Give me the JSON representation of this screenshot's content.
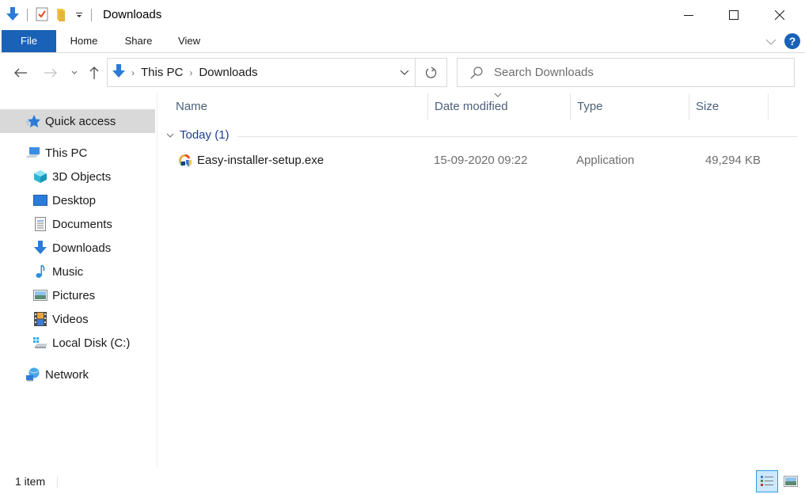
{
  "window": {
    "title": "Downloads",
    "controls": {
      "minimize": "minimize",
      "maximize": "maximize",
      "close": "close"
    }
  },
  "quick_access_toolbar": {
    "icons": [
      "downloads-arrow-icon",
      "properties-icon",
      "new-folder-icon",
      "customize-dropdown-icon"
    ]
  },
  "ribbon": {
    "tabs": [
      {
        "label": "File",
        "active": true
      },
      {
        "label": "Home"
      },
      {
        "label": "Share"
      },
      {
        "label": "View"
      }
    ],
    "help_label": "?"
  },
  "navigation": {
    "breadcrumb": [
      {
        "label": "This PC"
      },
      {
        "label": "Downloads"
      }
    ],
    "search_placeholder": "Search Downloads"
  },
  "sidebar": {
    "items": [
      {
        "label": "Quick access",
        "icon": "star-icon",
        "selected": true
      },
      {
        "label": "This PC",
        "icon": "computer-icon"
      },
      {
        "label": "3D Objects",
        "icon": "cube-icon"
      },
      {
        "label": "Desktop",
        "icon": "desktop-icon"
      },
      {
        "label": "Documents",
        "icon": "document-icon"
      },
      {
        "label": "Downloads",
        "icon": "download-icon"
      },
      {
        "label": "Music",
        "icon": "music-note-icon"
      },
      {
        "label": "Pictures",
        "icon": "picture-icon"
      },
      {
        "label": "Videos",
        "icon": "film-icon"
      },
      {
        "label": "Local Disk (C:)",
        "icon": "drive-icon"
      },
      {
        "label": "Network",
        "icon": "network-icon"
      }
    ]
  },
  "file_list": {
    "columns": [
      {
        "label": "Name"
      },
      {
        "label": "Date modified",
        "sorted": "descending"
      },
      {
        "label": "Type"
      },
      {
        "label": "Size"
      }
    ],
    "group": {
      "label": "Today (1)"
    },
    "rows": [
      {
        "name": "Easy-installer-setup.exe",
        "date_modified": "15-09-2020 09:22",
        "type": "Application",
        "size": "49,294 KB",
        "icon": "installer-icon"
      }
    ]
  },
  "status_bar": {
    "item_count": "1 item",
    "views": [
      {
        "name": "details-view",
        "active": true
      },
      {
        "name": "large-icons-view",
        "active": false
      }
    ]
  },
  "colors": {
    "accent": "#1a62b8",
    "selected_nav": "#d9d9d9",
    "group_header": "#1e3c96",
    "column_header": "#4c607a"
  }
}
